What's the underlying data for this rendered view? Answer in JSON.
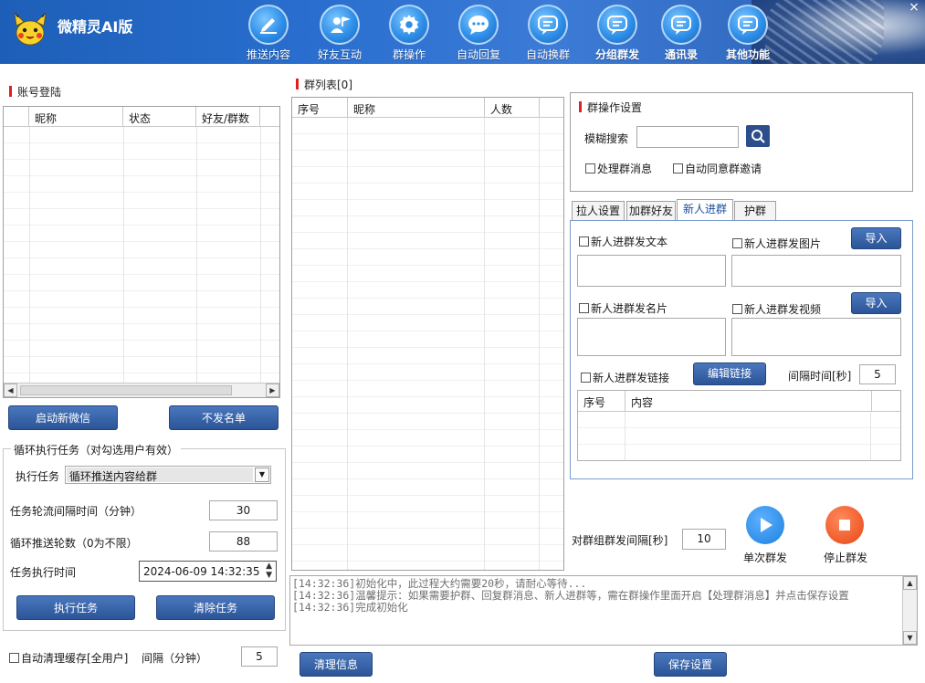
{
  "app": {
    "title": "微精灵AI版"
  },
  "nav": [
    {
      "label": "推送内容",
      "icon": "pen-icon"
    },
    {
      "label": "好友互动",
      "icon": "user-flag-icon"
    },
    {
      "label": "群操作",
      "icon": "gear-icon"
    },
    {
      "label": "自动回复",
      "icon": "chat-bubble-icon"
    },
    {
      "label": "自动换群",
      "icon": "chat-lines-icon"
    },
    {
      "label": "分组群发",
      "icon": "chat-lines-icon"
    },
    {
      "label": "通讯录",
      "icon": "chat-lines-icon"
    },
    {
      "label": "其他功能",
      "icon": "chat-lines-icon"
    }
  ],
  "accounts": {
    "title": "账号登陆",
    "columns": [
      "昵称",
      "状态",
      "好友/群数"
    ],
    "start_button": "启动新微信",
    "blacklist_button": "不发名单"
  },
  "loop_task": {
    "title": "循环执行任务（对勾选用户有效）",
    "task_label": "执行任务",
    "task_value": "循环推送内容给群",
    "interval_label": "任务轮流间隔时间（分钟）",
    "interval_value": "30",
    "rounds_label": "循环推送轮数（0为不限）",
    "rounds_value": "88",
    "time_label": "任务执行时间",
    "time_value": "2024-06-09 14:32:35",
    "run_button": "执行任务",
    "clear_button": "清除任务"
  },
  "auto_clear": {
    "label": "自动清理缓存[全用户]",
    "interval_label": "间隔（分钟）",
    "interval_value": "5"
  },
  "group_list": {
    "title": "群列表[0]",
    "columns": [
      "序号",
      "昵称",
      "人数"
    ]
  },
  "group_settings": {
    "title": "群操作设置",
    "search_label": "模糊搜索",
    "search_value": "",
    "handle_msg": "处理群消息",
    "auto_accept": "自动同意群邀请"
  },
  "tabs": [
    "拉人设置",
    "加群好友",
    "新人进群",
    "护群"
  ],
  "new_member": {
    "send_text": "新人进群发文本",
    "send_image": "新人进群发图片",
    "import1": "导入",
    "send_card": "新人进群发名片",
    "send_video": "新人进群发视频",
    "import2": "导入",
    "send_link": "新人进群发链接",
    "edit_link": "编辑链接",
    "interval_label": "间隔时间[秒]",
    "interval_value": "5",
    "columns": [
      "序号",
      "内容"
    ]
  },
  "broadcast": {
    "interval_label": "对群组群发间隔[秒]",
    "interval_value": "10",
    "single_label": "单次群发",
    "stop_label": "停止群发"
  },
  "log_lines": [
    "[14:32:36]初始化中，此过程大约需要20秒，请耐心等待...",
    "[14:32:36]温馨提示：如果需要护群、回复群消息、新人进群等，需在群操作里面开启【处理群消息】并点击保存设置",
    "[14:32:36]完成初始化"
  ],
  "footer": {
    "clear_info": "清理信息",
    "save_settings": "保存设置"
  },
  "colors": {
    "accent": "#2c5598",
    "header": "#2a6fd0",
    "play": "#2f8fe8",
    "stop": "#ef5a2a"
  }
}
